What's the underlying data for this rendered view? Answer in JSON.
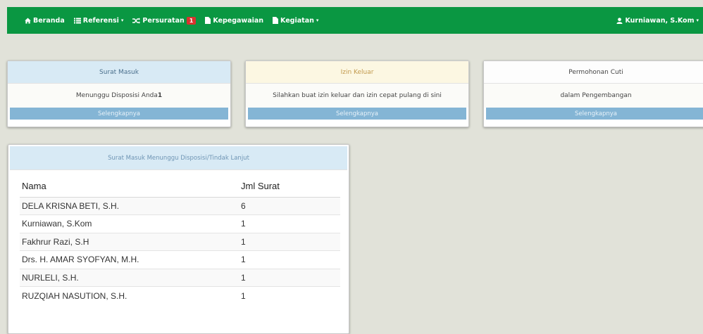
{
  "navbar": {
    "items": [
      {
        "label": "Beranda",
        "icon": "home-icon"
      },
      {
        "label": "Referensi",
        "icon": "list-icon",
        "caret": "▾"
      },
      {
        "label": "Persuratan",
        "icon": "shuffle-icon",
        "badge": "1"
      },
      {
        "label": "Kepegawaian",
        "icon": "file-icon"
      },
      {
        "label": "Kegiatan",
        "icon": "file-icon",
        "caret": "▾"
      }
    ],
    "user": {
      "label": "Kurniawan, S.Kom",
      "icon": "user-icon",
      "caret": "▾"
    }
  },
  "panels": {
    "surat_masuk": {
      "heading": "Surat Masuk",
      "body_text": "Menunggu Disposisi Anda ",
      "body_count": "1",
      "footer": "Selengkapnya"
    },
    "izin_keluar": {
      "heading": "Izin Keluar",
      "body_text": "Silahkan buat izin keluar dan izin cepat pulang di sini",
      "footer": "Selengkapnya"
    },
    "cuti": {
      "heading": "Permohonan Cuti",
      "body_text": "dalam Pengembangan",
      "footer": "Selengkapnya"
    }
  },
  "disposisi": {
    "heading": "Surat Masuk Menunggu Disposisi/Tindak Lanjut",
    "columns": [
      "Nama",
      "Jml Surat"
    ],
    "rows": [
      {
        "nama": "DELA KRISNA BETI, S.H.",
        "jml": "6"
      },
      {
        "nama": "Kurniawan, S.Kom",
        "jml": "1"
      },
      {
        "nama": "Fakhrur Razi, S.H",
        "jml": "1"
      },
      {
        "nama": "Drs. H. AMAR SYOFYAN, M.H.",
        "jml": "1"
      },
      {
        "nama": "NURLELI, S.H.",
        "jml": "1"
      },
      {
        "nama": "RUZQIAH NASUTION, S.H.",
        "jml": "1"
      }
    ]
  },
  "colors": {
    "navbar": "#0a9742",
    "badge": "#d9332f",
    "panel_footer": "#84b5d5",
    "page_bg": "#e1e2d9"
  }
}
